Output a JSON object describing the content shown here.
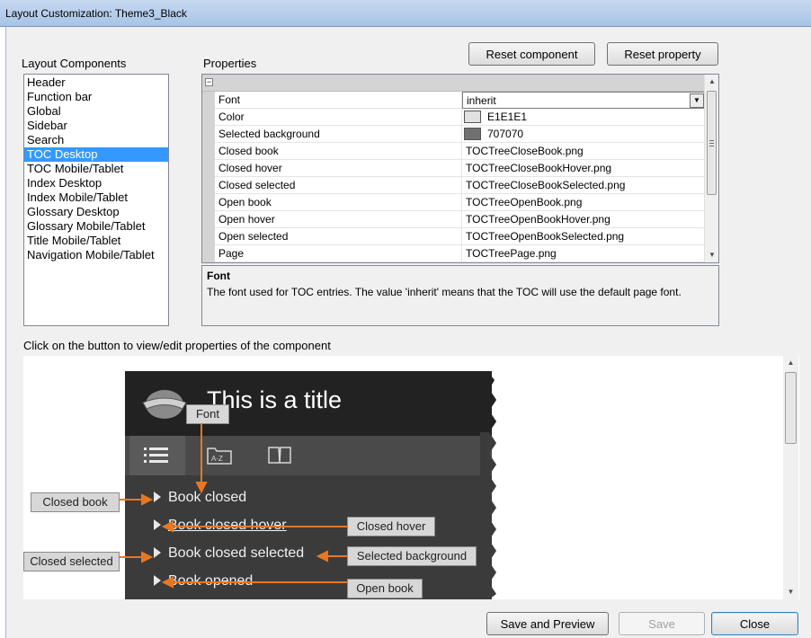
{
  "window": {
    "title": "Layout Customization: Theme3_Black"
  },
  "toolbar": {
    "reset_component": "Reset component",
    "reset_property": "Reset property"
  },
  "components": {
    "label": "Layout Components",
    "items": [
      "Header",
      "Function bar",
      "Global",
      "Sidebar",
      "Search",
      "TOC Desktop",
      "TOC Mobile/Tablet",
      "Index Desktop",
      "Index Mobile/Tablet",
      "Glossary Desktop",
      "Glossary Mobile/Tablet",
      "Title Mobile/Tablet",
      "Navigation Mobile/Tablet"
    ],
    "selected": "TOC Desktop"
  },
  "properties": {
    "label": "Properties",
    "rows": [
      {
        "name": "Font",
        "value": "inherit"
      },
      {
        "name": "Color",
        "value": "E1E1E1",
        "swatch": "#e1e1e1"
      },
      {
        "name": "Selected background",
        "value": "707070",
        "swatch": "#707070"
      },
      {
        "name": "Closed book",
        "value": "TOCTreeCloseBook.png"
      },
      {
        "name": "Closed hover",
        "value": "TOCTreeCloseBookHover.png"
      },
      {
        "name": "Closed selected",
        "value": "TOCTreeCloseBookSelected.png"
      },
      {
        "name": "Open book",
        "value": "TOCTreeOpenBook.png"
      },
      {
        "name": "Open hover",
        "value": "TOCTreeOpenBookHover.png"
      },
      {
        "name": "Open selected",
        "value": "TOCTreeOpenBookSelected.png"
      },
      {
        "name": "Page",
        "value": "TOCTreePage.png"
      }
    ]
  },
  "description": {
    "title": "Font",
    "text": "The font used for TOC entries. The value 'inherit' means that the TOC will use the default page font."
  },
  "preview": {
    "instruction": "Click on the button to view/edit properties of the component",
    "page_title": "This is a title",
    "toc_items": [
      "Book closed",
      "Book closed hover",
      "Book closed selected",
      "Book opened"
    ],
    "tab_az": "A-Z",
    "callouts": {
      "font": "Font",
      "closed_book": "Closed book",
      "closed_hover": "Closed hover",
      "closed_selected": "Closed selected",
      "selected_background": "Selected background",
      "open_book": "Open book"
    },
    "arrow_color": "#e87722"
  },
  "footer": {
    "save_preview": "Save and Preview",
    "save": "Save",
    "close": "Close"
  }
}
